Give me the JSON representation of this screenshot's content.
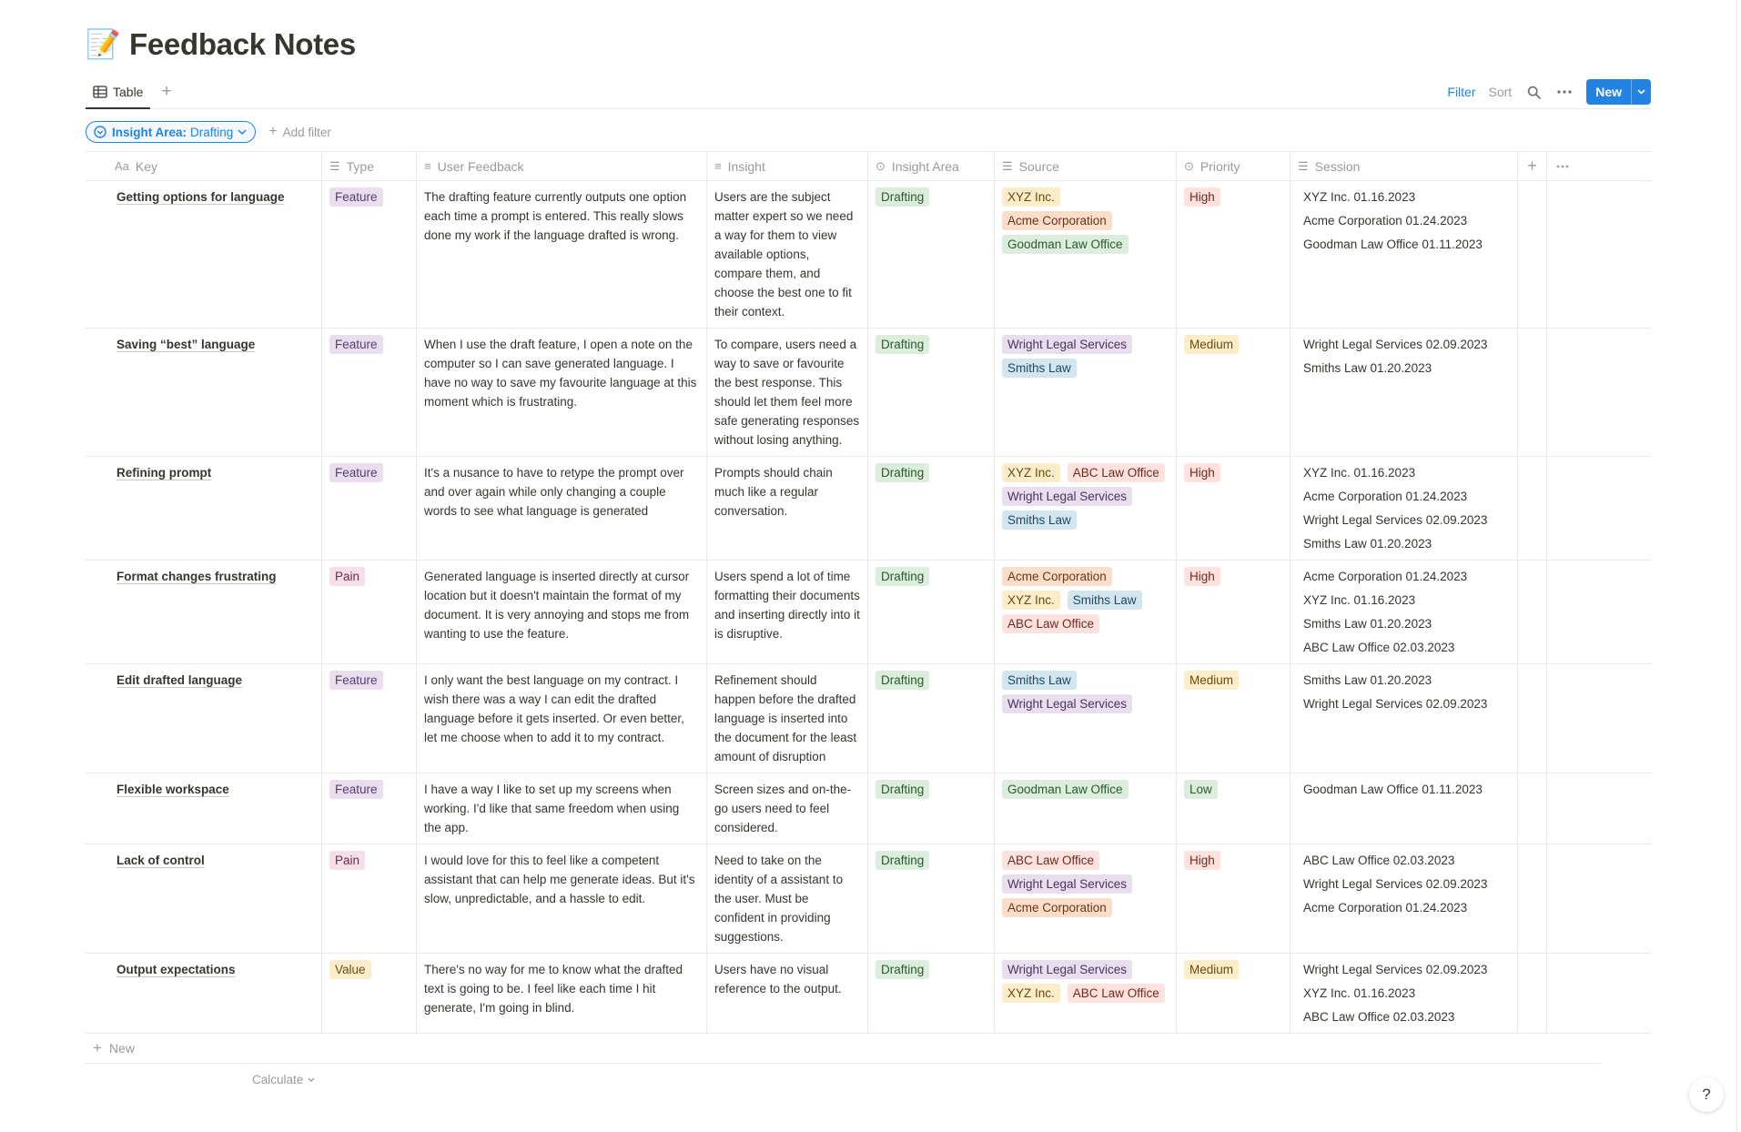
{
  "page": {
    "emoji": "📝",
    "title": "Feedback Notes"
  },
  "viewbar": {
    "tab_label": "Table",
    "filter_label": "Filter",
    "sort_label": "Sort",
    "new_label": "New"
  },
  "filter": {
    "prefix": "Insight Area:",
    "value": "Drafting",
    "add_label": "Add filter"
  },
  "columns": {
    "key": "Key",
    "type": "Type",
    "feedback": "User Feedback",
    "insight": "Insight",
    "area": "Insight Area",
    "source": "Source",
    "priority": "Priority",
    "session": "Session"
  },
  "tag_colors": {
    "Feature": [
      "#e8deee",
      "#5a3e73"
    ],
    "Pain": [
      "#f5e0e9",
      "#6f2d4c"
    ],
    "Value": [
      "#fbeccd",
      "#6b4f11"
    ],
    "Drafting": [
      "#dbeddb",
      "#2b5930"
    ],
    "High": [
      "#ffe2dd",
      "#6e2a20"
    ],
    "Medium": [
      "#fdecc8",
      "#6b4a10"
    ],
    "Low": [
      "#dbeddb",
      "#2b5930"
    ],
    "XYZ Inc.": [
      "#fdecc8",
      "#6b4a10"
    ],
    "Acme Corporation": [
      "#fadec9",
      "#6b3515"
    ],
    "Goodman Law Office": [
      "#dbeddb",
      "#2b5930"
    ],
    "Wright Legal Services": [
      "#e8deee",
      "#4d3360"
    ],
    "Smiths Law": [
      "#d3e5ef",
      "#1f4a63"
    ],
    "ABC Law Office": [
      "#ffe2dd",
      "#6e2a20"
    ]
  },
  "rows": [
    {
      "key": "Getting options for language",
      "type": "Feature",
      "feedback": "The drafting feature currently outputs one option each time a prompt is entered. This really slows done my work if the language drafted is wrong.",
      "insight": "Users are the subject matter expert so we need a way for them to view available options, compare them, and choose the best one to fit their context.",
      "area": "Drafting",
      "source": [
        "XYZ Inc.",
        "Acme Corporation",
        "Goodman Law Office"
      ],
      "priority": "High",
      "session": [
        "XYZ Inc. 01.16.2023",
        "Acme Corporation 01.24.2023",
        "Goodman Law Office 01.11.2023"
      ]
    },
    {
      "key": "Saving “best” language",
      "type": "Feature",
      "feedback": "When I use the draft feature, I open a note on the computer so I can save generated language. I have no way to save my favourite language at this moment which is frustrating.",
      "insight": "To compare, users need a way to save or favourite the best response. This should let them feel more safe generating responses without losing anything.",
      "area": "Drafting",
      "source": [
        "Wright Legal Services",
        "Smiths Law"
      ],
      "priority": "Medium",
      "session": [
        "Wright Legal Services 02.09.2023",
        "Smiths Law 01.20.2023"
      ]
    },
    {
      "key": "Refining prompt",
      "type": "Feature",
      "feedback": "It's a nusance to have to retype the prompt over and over again while only changing a couple words to see what language is generated",
      "insight": "Prompts should chain much like a regular conversation.",
      "area": "Drafting",
      "source": [
        "XYZ Inc.",
        "ABC Law Office",
        "Wright Legal Services",
        "Smiths Law"
      ],
      "priority": "High",
      "session": [
        "XYZ Inc. 01.16.2023",
        "Acme Corporation 01.24.2023",
        "Wright Legal Services 02.09.2023",
        "Smiths Law 01.20.2023"
      ]
    },
    {
      "key": "Format changes frustrating",
      "type": "Pain",
      "feedback": "Generated language is inserted directly at cursor location but it doesn't maintain the format of my document. It is very annoying and stops me from wanting to use the feature.",
      "insight": "Users spend a lot of time formatting their documents and inserting directly into it is disruptive.",
      "area": "Drafting",
      "source": [
        "Acme Corporation",
        "XYZ Inc.",
        "Smiths Law",
        "ABC Law Office"
      ],
      "priority": "High",
      "session": [
        "Acme Corporation 01.24.2023",
        "XYZ Inc. 01.16.2023",
        "Smiths Law 01.20.2023",
        "ABC Law Office 02.03.2023"
      ]
    },
    {
      "key": "Edit drafted language",
      "type": "Feature",
      "feedback": "I only want the best language on my contract. I wish there was a way I can edit the drafted language before it gets inserted. Or even better, let me choose when to add it to my contract.",
      "insight": "Refinement should happen before the drafted language is inserted into the document for the least amount of disruption",
      "area": "Drafting",
      "source": [
        "Smiths Law",
        "Wright Legal Services"
      ],
      "priority": "Medium",
      "session": [
        "Smiths Law 01.20.2023",
        "Wright Legal Services 02.09.2023"
      ]
    },
    {
      "key": "Flexible workspace",
      "type": "Feature",
      "feedback": "I have a way I like to set up my screens when working. I'd like that same freedom when using the app.",
      "insight": "Screen sizes and on-the-go users need to feel considered.",
      "area": "Drafting",
      "source": [
        "Goodman Law Office"
      ],
      "priority": "Low",
      "session": [
        "Goodman Law Office 01.11.2023"
      ]
    },
    {
      "key": "Lack of control",
      "type": "Pain",
      "feedback": "I would love for this to feel like a competent assistant that can help me generate ideas. But it's slow, unpredictable, and a hassle to edit.",
      "insight": "Need to take on the identity of a assistant to the user. Must be confident in providing suggestions.",
      "area": "Drafting",
      "source": [
        "ABC Law Office",
        "Wright Legal Services",
        "Acme Corporation"
      ],
      "priority": "High",
      "session": [
        "ABC Law Office 02.03.2023",
        "Wright Legal Services 02.09.2023",
        "Acme Corporation 01.24.2023"
      ]
    },
    {
      "key": "Output expectations",
      "type": "Value",
      "feedback": "There's no way for me to know what the drafted text is going to be. I feel like each time I hit generate, I'm going in blind.",
      "insight": "Users have no visual reference to the output.",
      "area": "Drafting",
      "source": [
        "Wright Legal Services",
        "XYZ Inc.",
        "ABC Law Office"
      ],
      "priority": "Medium",
      "session": [
        "Wright Legal Services 02.09.2023",
        "XYZ Inc. 01.16.2023",
        "ABC Law Office 02.03.2023"
      ]
    }
  ],
  "footer": {
    "new_label": "New",
    "calculate_label": "Calculate"
  }
}
